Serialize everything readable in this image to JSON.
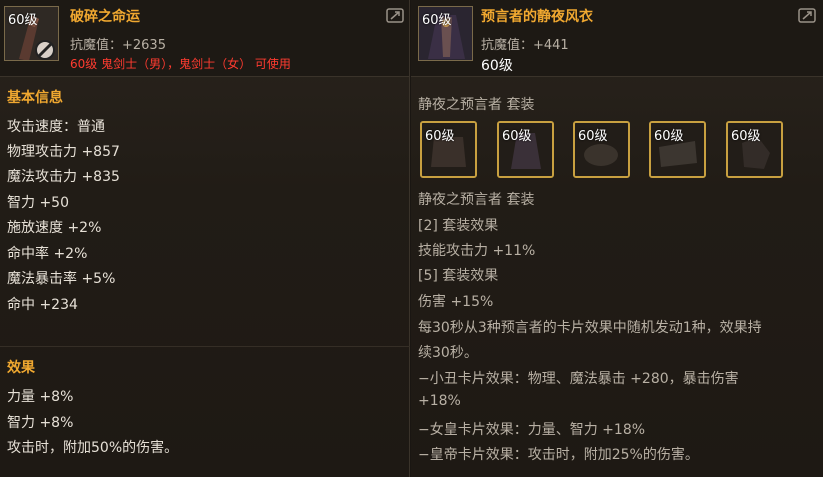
{
  "left": {
    "level_tag": "60级",
    "name": "破碎之命运",
    "anti_magic": "抗魔值：+2635",
    "requirement": "60级 鬼剑士（男），鬼剑士（女） 可使用",
    "basic_title": "基本信息",
    "stats": [
      "攻击速度：普通",
      "物理攻击力 +857",
      "魔法攻击力 +835",
      "智力 +50",
      "施放速度 +2%",
      "命中率 +2%",
      "魔法暴击率 +5%",
      "命中 +234"
    ],
    "effect_title": "效果",
    "effects": [
      "力量 +8%",
      "智力 +8%",
      "攻击时，附加50%的伤害。"
    ]
  },
  "right": {
    "level_tag": "60级",
    "name": "预言者的静夜风衣",
    "anti_magic": "抗魔值：+441",
    "level": "60级",
    "set_name": "静夜之预言者  套装",
    "set_slots": [
      "60级",
      "60级",
      "60级",
      "60级",
      "60级"
    ],
    "set_name2": "静夜之预言者  套装",
    "lines": [
      "[2] 套装效果",
      "技能攻击力 +11%",
      "[5] 套装效果",
      "伤害 +15%",
      "每30秒从3种预言者的卡片效果中随机发动1种，效果持",
      "续30秒。",
      "−小丑卡片效果：物理、魔法暴击 +280，暴击伤害",
      "+18%",
      "−女皇卡片效果：力量、智力 +18%",
      "−皇帝卡片效果：攻击时，附加25%的伤害。"
    ]
  },
  "colors": {
    "name": "#f0a830",
    "requirement": "#ff3b30",
    "text": "#e6e0d6",
    "muted": "#b8b0a4",
    "slot_border": "#c8a040"
  }
}
